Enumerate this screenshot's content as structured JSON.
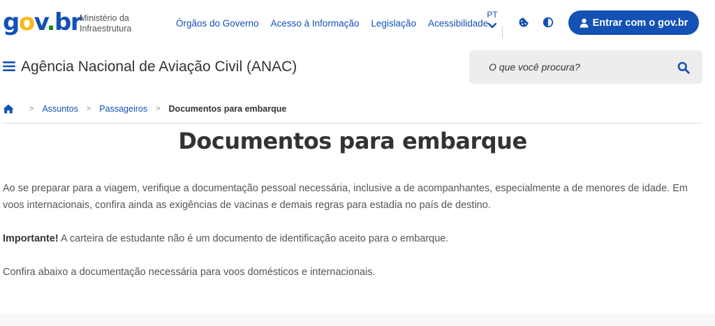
{
  "header": {
    "logo": {
      "g": "g",
      "o": "o",
      "v": "v",
      "dot": ".",
      "b": "b",
      "r": "r"
    },
    "ministry_line1": "Ministério da",
    "ministry_line2": "Infraestrutura",
    "nav": [
      {
        "label": "Órgãos do Governo"
      },
      {
        "label": "Acesso à Informação"
      },
      {
        "label": "Legislação"
      },
      {
        "label": "Acessibilidade"
      }
    ],
    "language": "PT",
    "login_prefix": "Entrar com o ",
    "login_brand": "gov.br",
    "colors": {
      "primary": "#1351b4",
      "logo_yellow": "#f8b91a",
      "logo_green": "#168821"
    }
  },
  "site": {
    "agency_name": "Agência Nacional de Aviação Civil (ANAC)",
    "search_placeholder": "O que você procura?"
  },
  "breadcrumb": {
    "items": [
      {
        "label": "Assuntos"
      },
      {
        "label": "Passageiros"
      }
    ],
    "current": "Documentos para embarque"
  },
  "content": {
    "title": "Documentos para embarque",
    "paragraph1": "Ao se preparar para a viagem, verifique a documentação pessoal necessária, inclusive a de acompanhantes, especialmente a de menores de idade. Em voos internacionais, confira ainda as exigências de vacinas e demais regras para estadia no país de destino.",
    "paragraph2_bold": "Importante!",
    "paragraph2_rest": " A carteira de estudante não é um documento de identificação aceito para o embarque.",
    "paragraph3": "Confira abaixo a documentação necessária para voos domésticos e internacionais."
  }
}
